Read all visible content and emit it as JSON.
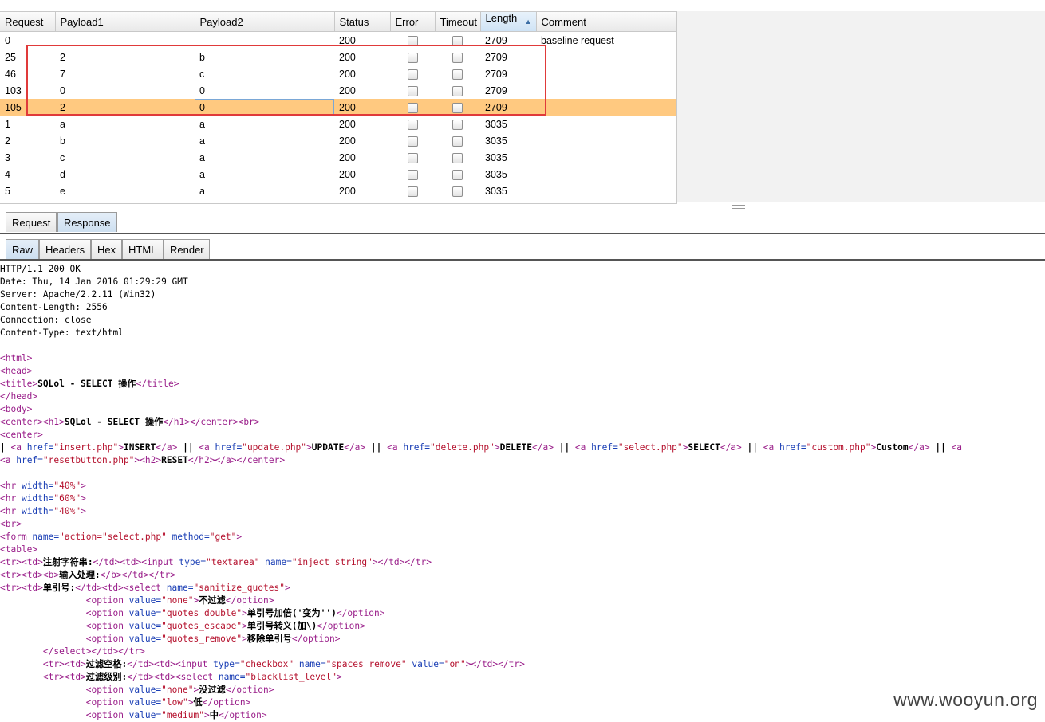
{
  "columns": [
    "Request",
    "Payload1",
    "Payload2",
    "Status",
    "Error",
    "Timeout",
    "Length",
    "Comment"
  ],
  "sort_indicator": "▲",
  "rows": [
    {
      "request": "0",
      "p1": "",
      "p2": "",
      "status": "200",
      "length": "2709",
      "comment": "baseline request"
    },
    {
      "request": "25",
      "p1": "2",
      "p2": "b",
      "status": "200",
      "length": "2709",
      "comment": ""
    },
    {
      "request": "46",
      "p1": "7",
      "p2": "c",
      "status": "200",
      "length": "2709",
      "comment": ""
    },
    {
      "request": "103",
      "p1": "0",
      "p2": "0",
      "status": "200",
      "length": "2709",
      "comment": ""
    },
    {
      "request": "105",
      "p1": "2",
      "p2": "0",
      "status": "200",
      "length": "2709",
      "comment": ""
    },
    {
      "request": "1",
      "p1": "a",
      "p2": "a",
      "status": "200",
      "length": "3035",
      "comment": ""
    },
    {
      "request": "2",
      "p1": "b",
      "p2": "a",
      "status": "200",
      "length": "3035",
      "comment": ""
    },
    {
      "request": "3",
      "p1": "c",
      "p2": "a",
      "status": "200",
      "length": "3035",
      "comment": ""
    },
    {
      "request": "4",
      "p1": "d",
      "p2": "a",
      "status": "200",
      "length": "3035",
      "comment": ""
    },
    {
      "request": "5",
      "p1": "e",
      "p2": "a",
      "status": "200",
      "length": "3035",
      "comment": ""
    }
  ],
  "selected_row": "105",
  "tabs_top": [
    "Request",
    "Response"
  ],
  "tabs_view": [
    "Raw",
    "Headers",
    "Hex",
    "HTML",
    "Render"
  ],
  "headers_text": [
    "HTTP/1.1 200 OK",
    "Date: Thu, 14 Jan 2016 01:29:29 GMT",
    "Server: Apache/2.2.11 (Win32)",
    "Content-Length: 2556",
    "Connection: close",
    "Content-Type: text/html"
  ],
  "body_lines": [
    [],
    [
      [
        "t",
        "<html>"
      ]
    ],
    [
      [
        "t",
        "<head>"
      ]
    ],
    [
      [
        "t",
        "<title>"
      ],
      [
        "x",
        "SQLol - SELECT 操作"
      ],
      [
        "t",
        "</title>"
      ]
    ],
    [
      [
        "t",
        "</head>"
      ]
    ],
    [
      [
        "t",
        "<body>"
      ]
    ],
    [
      [
        "t",
        "<center>"
      ],
      [
        "t",
        "<h1>"
      ],
      [
        "x",
        "SQLol - SELECT 操作"
      ],
      [
        "t",
        "</h1>"
      ],
      [
        "t",
        "</center>"
      ],
      [
        "t",
        "<br>"
      ]
    ],
    [
      [
        "t",
        "<center>"
      ]
    ],
    [
      [
        "x",
        "| "
      ],
      [
        "t",
        "<a "
      ],
      [
        "a",
        "href="
      ],
      [
        "v",
        "\"insert.php\""
      ],
      [
        "t",
        ">"
      ],
      [
        "x",
        "INSERT"
      ],
      [
        "t",
        "</a>"
      ],
      [
        "x",
        " || "
      ],
      [
        "t",
        "<a "
      ],
      [
        "a",
        "href="
      ],
      [
        "v",
        "\"update.php\""
      ],
      [
        "t",
        ">"
      ],
      [
        "x",
        "UPDATE"
      ],
      [
        "t",
        "</a>"
      ],
      [
        "x",
        " || "
      ],
      [
        "t",
        "<a "
      ],
      [
        "a",
        "href="
      ],
      [
        "v",
        "\"delete.php\""
      ],
      [
        "t",
        ">"
      ],
      [
        "x",
        "DELETE"
      ],
      [
        "t",
        "</a>"
      ],
      [
        "x",
        " || "
      ],
      [
        "t",
        "<a "
      ],
      [
        "a",
        "href="
      ],
      [
        "v",
        "\"select.php\""
      ],
      [
        "t",
        ">"
      ],
      [
        "x",
        "SELECT"
      ],
      [
        "t",
        "</a>"
      ],
      [
        "x",
        " || "
      ],
      [
        "t",
        "<a "
      ],
      [
        "a",
        "href="
      ],
      [
        "v",
        "\"custom.php\""
      ],
      [
        "t",
        ">"
      ],
      [
        "x",
        "Custom"
      ],
      [
        "t",
        "</a>"
      ],
      [
        "x",
        " || "
      ],
      [
        "t",
        "<a"
      ]
    ],
    [
      [
        "t",
        "<a "
      ],
      [
        "a",
        "href="
      ],
      [
        "v",
        "\"resetbutton.php\""
      ],
      [
        "t",
        ">"
      ],
      [
        "t",
        "<h2>"
      ],
      [
        "x",
        "RESET"
      ],
      [
        "t",
        "</h2>"
      ],
      [
        "t",
        "</a>"
      ],
      [
        "t",
        "</center>"
      ]
    ],
    [],
    [
      [
        "t",
        "<hr "
      ],
      [
        "a",
        "width="
      ],
      [
        "v",
        "\"40%\""
      ],
      [
        "t",
        ">"
      ]
    ],
    [
      [
        "t",
        "<hr "
      ],
      [
        "a",
        "width="
      ],
      [
        "v",
        "\"60%\""
      ],
      [
        "t",
        ">"
      ]
    ],
    [
      [
        "t",
        "<hr "
      ],
      [
        "a",
        "width="
      ],
      [
        "v",
        "\"40%\""
      ],
      [
        "t",
        ">"
      ]
    ],
    [
      [
        "t",
        "<br>"
      ]
    ],
    [
      [
        "t",
        "<form "
      ],
      [
        "a",
        "name="
      ],
      [
        "v",
        "\"action=\"select.php\""
      ],
      [
        "a",
        " method="
      ],
      [
        "v",
        "\"get\""
      ],
      [
        "t",
        ">"
      ]
    ],
    [
      [
        "t",
        "<table>"
      ]
    ],
    [
      [
        "t",
        "<tr>"
      ],
      [
        "t",
        "<td>"
      ],
      [
        "x",
        "注射字符串:"
      ],
      [
        "t",
        "</td>"
      ],
      [
        "t",
        "<td>"
      ],
      [
        "t",
        "<input "
      ],
      [
        "a",
        "type="
      ],
      [
        "v",
        "\"textarea\""
      ],
      [
        "a",
        " name="
      ],
      [
        "v",
        "\"inject_string\""
      ],
      [
        "t",
        ">"
      ],
      [
        "t",
        "</td>"
      ],
      [
        "t",
        "</tr>"
      ]
    ],
    [
      [
        "t",
        "<tr>"
      ],
      [
        "t",
        "<td>"
      ],
      [
        "t",
        "<b>"
      ],
      [
        "x",
        "输入处理:"
      ],
      [
        "t",
        "</b>"
      ],
      [
        "t",
        "</td>"
      ],
      [
        "t",
        "</tr>"
      ]
    ],
    [
      [
        "t",
        "<tr>"
      ],
      [
        "t",
        "<td>"
      ],
      [
        "x",
        "单引号:"
      ],
      [
        "t",
        "</td>"
      ],
      [
        "t",
        "<td>"
      ],
      [
        "t",
        "<select "
      ],
      [
        "a",
        "name="
      ],
      [
        "v",
        "\"sanitize_quotes\""
      ],
      [
        "t",
        ">"
      ]
    ],
    [
      [
        "x",
        "                "
      ],
      [
        "t",
        "<option "
      ],
      [
        "a",
        "value="
      ],
      [
        "v",
        "\"none\""
      ],
      [
        "t",
        ">"
      ],
      [
        "x",
        "不过滤"
      ],
      [
        "t",
        "</option>"
      ]
    ],
    [
      [
        "x",
        "                "
      ],
      [
        "t",
        "<option "
      ],
      [
        "a",
        "value="
      ],
      [
        "v",
        "\"quotes_double\""
      ],
      [
        "t",
        ">"
      ],
      [
        "x",
        "单引号加倍('变为'')"
      ],
      [
        "t",
        "</option>"
      ]
    ],
    [
      [
        "x",
        "                "
      ],
      [
        "t",
        "<option "
      ],
      [
        "a",
        "value="
      ],
      [
        "v",
        "\"quotes_escape\""
      ],
      [
        "t",
        ">"
      ],
      [
        "x",
        "单引号转义(加\\)"
      ],
      [
        "t",
        "</option>"
      ]
    ],
    [
      [
        "x",
        "                "
      ],
      [
        "t",
        "<option "
      ],
      [
        "a",
        "value="
      ],
      [
        "v",
        "\"quotes_remove\""
      ],
      [
        "t",
        ">"
      ],
      [
        "x",
        "移除单引号"
      ],
      [
        "t",
        "</option>"
      ]
    ],
    [
      [
        "x",
        "        "
      ],
      [
        "t",
        "</select>"
      ],
      [
        "t",
        "</td>"
      ],
      [
        "t",
        "</tr>"
      ]
    ],
    [
      [
        "x",
        "        "
      ],
      [
        "t",
        "<tr>"
      ],
      [
        "t",
        "<td>"
      ],
      [
        "x",
        "过滤空格:"
      ],
      [
        "t",
        "</td>"
      ],
      [
        "t",
        "<td>"
      ],
      [
        "t",
        "<input "
      ],
      [
        "a",
        "type="
      ],
      [
        "v",
        "\"checkbox\""
      ],
      [
        "a",
        " name="
      ],
      [
        "v",
        "\"spaces_remove\""
      ],
      [
        "a",
        " value="
      ],
      [
        "v",
        "\"on\""
      ],
      [
        "t",
        ">"
      ],
      [
        "t",
        "</td>"
      ],
      [
        "t",
        "</tr>"
      ]
    ],
    [
      [
        "x",
        "        "
      ],
      [
        "t",
        "<tr>"
      ],
      [
        "t",
        "<td>"
      ],
      [
        "x",
        "过滤级别:"
      ],
      [
        "t",
        "</td>"
      ],
      [
        "t",
        "<td>"
      ],
      [
        "t",
        "<select "
      ],
      [
        "a",
        "name="
      ],
      [
        "v",
        "\"blacklist_level\""
      ],
      [
        "t",
        ">"
      ]
    ],
    [
      [
        "x",
        "                "
      ],
      [
        "t",
        "<option "
      ],
      [
        "a",
        "value="
      ],
      [
        "v",
        "\"none\""
      ],
      [
        "t",
        ">"
      ],
      [
        "x",
        "没过滤"
      ],
      [
        "t",
        "</option>"
      ]
    ],
    [
      [
        "x",
        "                "
      ],
      [
        "t",
        "<option "
      ],
      [
        "a",
        "value="
      ],
      [
        "v",
        "\"low\""
      ],
      [
        "t",
        ">"
      ],
      [
        "x",
        "低"
      ],
      [
        "t",
        "</option>"
      ]
    ],
    [
      [
        "x",
        "                "
      ],
      [
        "t",
        "<option "
      ],
      [
        "a",
        "value="
      ],
      [
        "v",
        "\"medium\""
      ],
      [
        "t",
        ">"
      ],
      [
        "x",
        "中"
      ],
      [
        "t",
        "</option>"
      ]
    ]
  ],
  "watermark": "www.wooyun.org"
}
